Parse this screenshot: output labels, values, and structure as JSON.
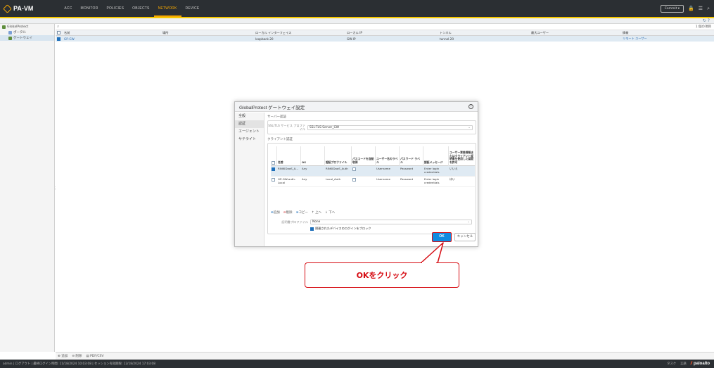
{
  "app": {
    "title": "PA-VM"
  },
  "nav": {
    "tabs": [
      {
        "label": "ACC"
      },
      {
        "label": "MONITOR"
      },
      {
        "label": "POLICIES"
      },
      {
        "label": "OBJECTS"
      },
      {
        "label": "NETWORK"
      },
      {
        "label": "DEVICE"
      }
    ],
    "active": "NETWORK",
    "commit_label": "Commit ▾"
  },
  "sidebar": {
    "items": [
      {
        "label": "GlobalProtect"
      },
      {
        "label": "ポータル"
      },
      {
        "label": "ゲートウェイ"
      }
    ]
  },
  "main": {
    "items_count": "1 個の項目",
    "columns": [
      "名前",
      "場所",
      "ローカル インターフェイス",
      "ローカル IP",
      "トンネル",
      "最大ユーザー",
      "情報"
    ],
    "rows": [
      {
        "name": "GP-GW",
        "location": "",
        "interface": "loopback.20",
        "local_ip": "GW-IP",
        "tunnel": "tunnel.20",
        "max_users": "",
        "info": "リモート ユーザー"
      }
    ]
  },
  "bottom_tools": {
    "add": "追加",
    "delete": "削除",
    "pdf": "PDF/CSV"
  },
  "status": {
    "left": "admin | ログアウト | 最終ログイン時間: 11/18/2024 10:03:08 | セッション有効期限: 12/18/2024 17:03:08",
    "right_a": "タスク",
    "right_b": "言語",
    "brand": "paloalto"
  },
  "modal": {
    "title": "GlobalProtect ゲートウェイ設定",
    "tabs": [
      {
        "label": "全般"
      },
      {
        "label": "認証"
      },
      {
        "label": "エージェント"
      },
      {
        "label": "サテライト"
      }
    ],
    "active_tab": "認証",
    "server_auth": {
      "section": "サーバー認証",
      "label": "SSL/TLS サービス プロファイル",
      "value": "SSL-TLS-Server_GW"
    },
    "client_auth": {
      "section": "クライアント認証",
      "columns": [
        "名前",
        "OS",
        "認証プロファイル",
        "パスコードを自動取得",
        "ユーザー名のラベル",
        "パスワード ラベル",
        "認証メッセージ",
        "ユーザー資格情報またはクライアント証明書を使用した認証を許可"
      ],
      "rows": [
        {
          "name": "RINKIDaaS_A...",
          "os": "Any",
          "profile": "RINKIDaaS_Auth",
          "username": "Username",
          "password": "Password",
          "message": "Enter login credentials",
          "allow": "いいえ",
          "selected": true
        },
        {
          "name": "GP-GW-auth-Local",
          "os": "Any",
          "profile": "Local_Auth",
          "username": "Username",
          "password": "Password",
          "message": "Enter login credentials",
          "allow": "はい",
          "selected": false
        }
      ],
      "tools": {
        "add": "追加",
        "delete": "削除",
        "copy": "コピー",
        "up": "上へ",
        "down": "下へ"
      }
    },
    "cert_profile": {
      "label": "証明書プロファイル",
      "value": "None"
    },
    "block_label": "隔離されたデバイスのログインをブロック",
    "ok_label": "OK",
    "cancel_label": "キャンセル"
  },
  "callout": {
    "text": "OKをクリック"
  },
  "colors": {
    "accent": "#f7a800",
    "ok_button": "#0f8be0",
    "callout_red": "#d60b12",
    "topbar": "#2b2f33"
  }
}
